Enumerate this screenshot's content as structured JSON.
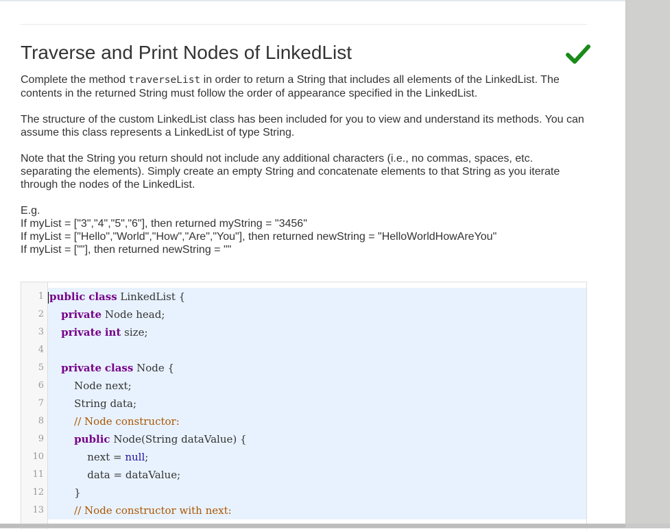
{
  "problem": {
    "title": "Traverse and Print Nodes of LinkedList",
    "paragraph1_before": "Complete the method ",
    "paragraph1_method": "traverseList",
    "paragraph1_after": " in order to return a String that includes all elements of the LinkedList. The contents in the returned String must follow the order of appearance specified in the LinkedList.",
    "paragraph2": "The structure of the custom LinkedList class has been included for you to view and understand its methods. You can assume this class represents a LinkedList of type String.",
    "paragraph3": "Note that the String you return should not include any additional characters (i.e., no commas, spaces, etc. separating the elements). Simply create an empty String and concatenate elements to that String as you iterate through the nodes of the LinkedList.",
    "examples": [
      "E.g.",
      "If myList = [\"3\",\"4\",\"5\",\"6\"], then returned myString = \"3456\"",
      "If myList = [\"Hello\",\"World\",\"How\",\"Are\",\"You\"], then returned newString = \"HelloWorldHowAreYou\"",
      "If myList = [\"\"], then returned newString = \"\""
    ],
    "status": {
      "icon": "check-icon",
      "color": "#1a8a1a"
    }
  },
  "editor": {
    "lines": [
      {
        "n": "1",
        "text": "public class LinkedList {"
      },
      {
        "n": "2",
        "text": "    private Node head;"
      },
      {
        "n": "3",
        "text": "    private int size;"
      },
      {
        "n": "4",
        "text": ""
      },
      {
        "n": "5",
        "text": "    private class Node {"
      },
      {
        "n": "6",
        "text": "        Node next;"
      },
      {
        "n": "7",
        "text": "        String data;"
      },
      {
        "n": "8",
        "text": "        // Node constructor:"
      },
      {
        "n": "9",
        "text": "        public Node(String dataValue) {"
      },
      {
        "n": "10",
        "text": "            next = null;"
      },
      {
        "n": "11",
        "text": "            data = dataValue;"
      },
      {
        "n": "12",
        "text": "        }"
      },
      {
        "n": "13",
        "text": "        // Node constructor with next:"
      }
    ],
    "colors": {
      "keyword": "#770088",
      "comment": "#aa5500",
      "literal": "#221199",
      "active_line": "#e8f2fe"
    }
  }
}
